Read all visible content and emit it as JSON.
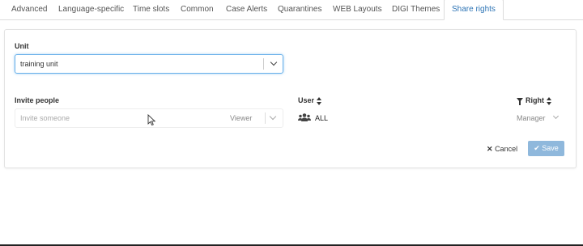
{
  "tabs": [
    {
      "label": "Advanced"
    },
    {
      "label": "Language-specific"
    },
    {
      "label": "Time slots"
    },
    {
      "label": "Common"
    },
    {
      "label": "Case Alerts"
    },
    {
      "label": "Quarantines"
    },
    {
      "label": "WEB Layouts"
    },
    {
      "label": "DIGI Themes"
    },
    {
      "label": "Share rights",
      "active": true
    }
  ],
  "unit": {
    "label": "Unit",
    "value": "training unit"
  },
  "invite": {
    "label": "Invite people",
    "placeholder": "Invite someone",
    "role": "Viewer"
  },
  "table": {
    "user_header": "User",
    "right_header": "Right",
    "rows": [
      {
        "user": "ALL",
        "right": "Manager"
      }
    ]
  },
  "actions": {
    "cancel_label": "Cancel",
    "save_label": "Save"
  },
  "colors": {
    "accent": "#2d74b5",
    "save_button": "#8fb8dc"
  }
}
